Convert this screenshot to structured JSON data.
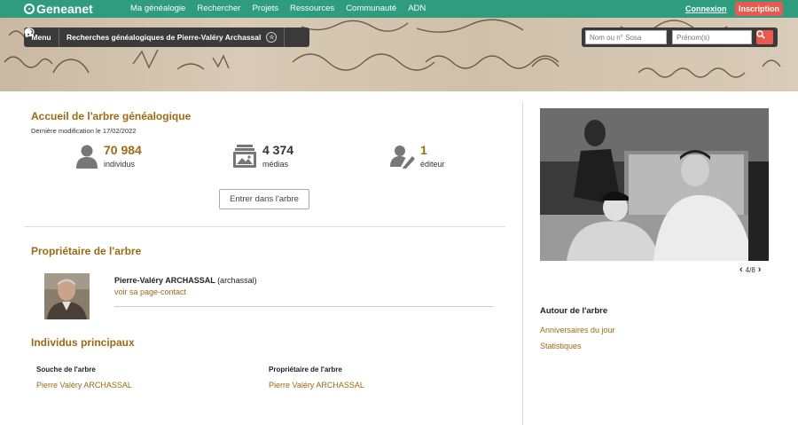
{
  "topnav": {
    "logo": "Geneanet",
    "links": [
      "Ma généalogie",
      "Rechercher",
      "Projets",
      "Ressources",
      "Communauté",
      "ADN"
    ],
    "login": "Connexion",
    "signup": "Inscription",
    "bg_color": "#2e9c7d"
  },
  "toolbar": {
    "menu_label": "Menu",
    "breadcrumb": "Recherches généalogiques de Pierre-Valéry Archassal",
    "badge_icon": "geneastar-icon",
    "chat_icon": "speech-bubble-icon"
  },
  "search": {
    "sosa_placeholder": "Nom ou n° Sosa",
    "firstname_placeholder": "Prénom(s)",
    "button_icon": "search-icon"
  },
  "home": {
    "title": "Accueil de l'arbre généalogique",
    "last_modified": "Dernière modification le 17/02/2022",
    "stats": [
      {
        "value": "70 984",
        "label": "individus",
        "icon": "person-icon"
      },
      {
        "value": "4 374",
        "label": "médias",
        "icon": "media-icon"
      },
      {
        "value": "1",
        "label": "éditeur",
        "icon": "editor-icon"
      }
    ],
    "enter_button": "Entrer dans l'arbre"
  },
  "owner": {
    "title": "Propriétaire de l'arbre",
    "name": "Pierre-Valéry ARCHASSAL",
    "pseudo": "(archassal)",
    "contact_link": "voir sa page-contact"
  },
  "main_people": {
    "title": "Individus principaux",
    "columns": [
      {
        "header": "Souche de l'arbre",
        "value": "Pierre Valéry ARCHASSAL"
      },
      {
        "header": "Propriétaire de l'arbre",
        "value": "Pierre Valéry ARCHASSAL"
      }
    ]
  },
  "sidebar": {
    "pager": "4/8",
    "title": "Autour de l'arbre",
    "links": [
      "Anniversaires du jour",
      "Statistiques"
    ]
  },
  "colors": {
    "accent": "#9c6a14",
    "search_button": "#e85a4f",
    "toolbar": "#3a3a3a"
  }
}
